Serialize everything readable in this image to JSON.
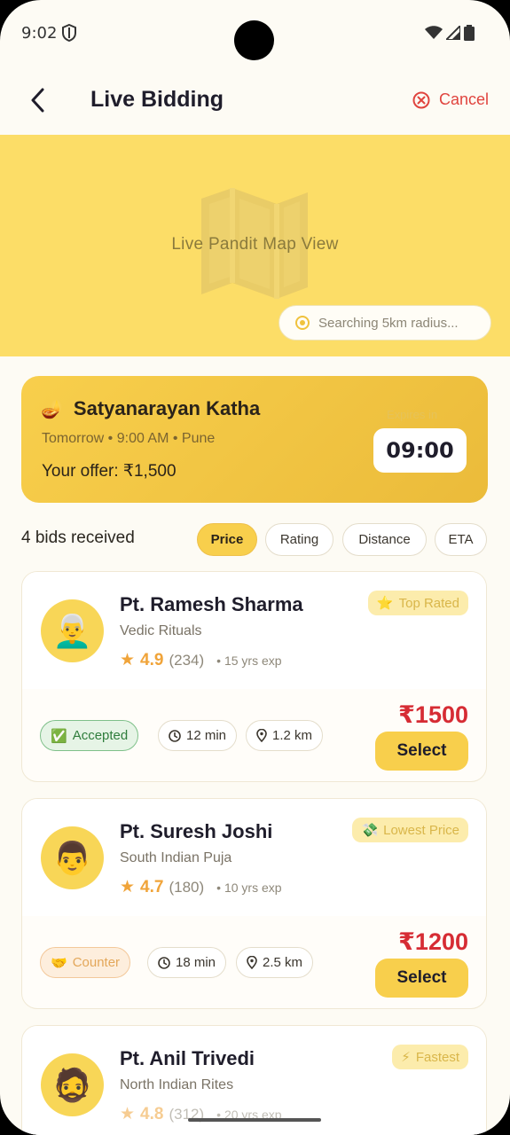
{
  "status_bar": {
    "time": "9:02"
  },
  "header": {
    "title": "Live Bidding",
    "cancel_label": "Cancel"
  },
  "map": {
    "label": "Live Pandit Map View",
    "search_status": "Searching 5km radius..."
  },
  "booking": {
    "title": "Satyanarayan Katha",
    "meta": "Tomorrow • 9:00 AM • Pune",
    "offer": "Your offer: ₹1,500",
    "expires_label": "Expires in",
    "timer": "09:00"
  },
  "bids": {
    "count_label": "4 bids received",
    "sort_options": [
      "Price",
      "Rating",
      "Distance",
      "ETA"
    ],
    "selected_sort": "Price",
    "items": [
      {
        "avatar": "👨‍🦳",
        "name": "Pt. Ramesh Sharma",
        "specialty": "Vedic Rituals",
        "rating": "4.9",
        "reviews": "(234)",
        "experience": "• 15 yrs exp",
        "badge_icon": "⭐",
        "badge": "Top Rated",
        "status_icon": "✅",
        "status": "Accepted",
        "eta": "12 min",
        "distance": "1.2 km",
        "price": "₹1500",
        "select_label": "Select"
      },
      {
        "avatar": "👨",
        "name": "Pt. Suresh Joshi",
        "specialty": "South Indian Puja",
        "rating": "4.7",
        "reviews": "(180)",
        "experience": "• 10 yrs exp",
        "badge_icon": "💸",
        "badge": "Lowest Price",
        "status_icon": "🤝",
        "status": "Counter",
        "eta": "18 min",
        "distance": "2.5 km",
        "price": "₹1200",
        "select_label": "Select"
      },
      {
        "avatar": "🧔",
        "name": "Pt. Anil Trivedi",
        "specialty": "North Indian Rites",
        "rating": "4.8",
        "reviews": "(312)",
        "experience": "• 20 yrs exp",
        "badge_icon": "⚡",
        "badge": "Fastest"
      }
    ]
  },
  "colors": {
    "accent": "#f8cf4c",
    "price": "#d62c34",
    "cancel": "#e0443e",
    "star": "#f0a43a"
  }
}
